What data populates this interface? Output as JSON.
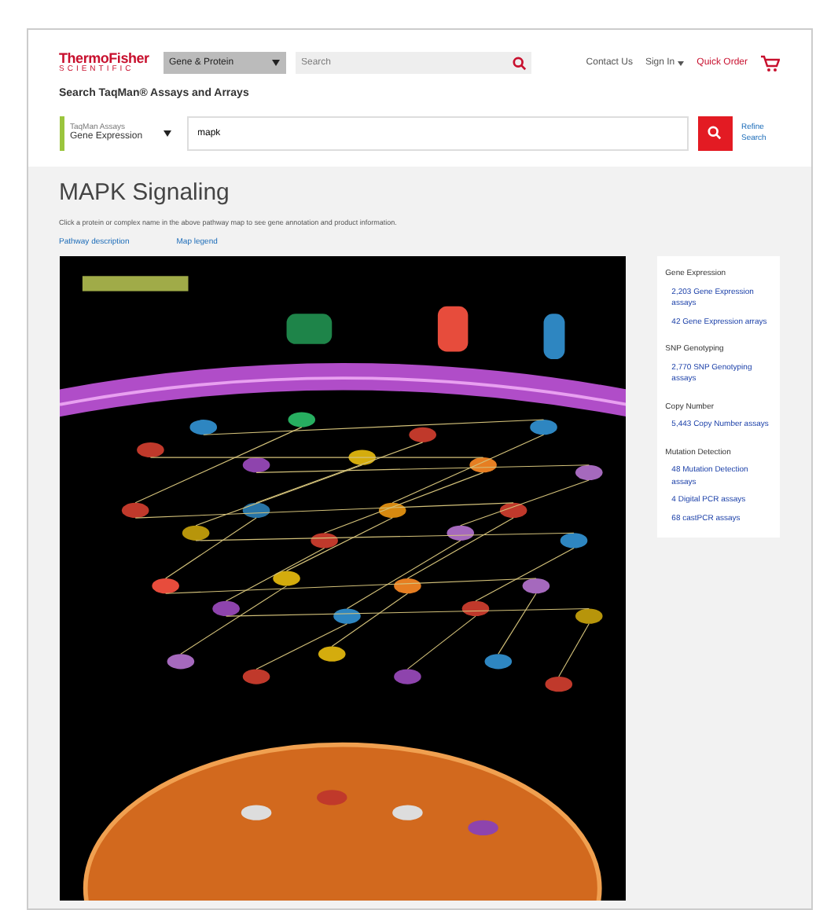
{
  "header": {
    "logo": {
      "line1": "ThermoFisher",
      "line2": "SCIENTIFIC"
    },
    "scope_dropdown": "Gene & Protein",
    "search": {
      "placeholder": "Search"
    },
    "links": [
      {
        "label": "Contact Us",
        "kind": "link"
      },
      {
        "label": "Sign In",
        "kind": "menu"
      },
      {
        "label": "Quick Order",
        "kind": "accent"
      }
    ]
  },
  "assay_search": {
    "title": "Search TaqMan® Assays and Arrays",
    "category": {
      "line1": "TaqMan Assays",
      "line2": "Gene Expression"
    },
    "value": "mapk",
    "side_link": {
      "line1": "Refine",
      "line2": "Search"
    }
  },
  "page": {
    "title": "MAPK Signaling",
    "description": "Click a protein or complex name in the above pathway map to see gene annotation and product information.",
    "links": [
      "Pathway description",
      "Map legend"
    ]
  },
  "sidebar": [
    {
      "heading": "Gene Expression",
      "items": [
        "2,203 Gene Expression assays",
        "42 Gene Expression arrays"
      ]
    },
    {
      "heading": "SNP Genotyping",
      "items": [
        "2,770 SNP Genotyping assays"
      ]
    },
    {
      "heading": "Copy Number",
      "items": [
        "5,443 Copy Number assays"
      ]
    },
    {
      "heading": "Mutation Detection",
      "items": [
        "48 Mutation Detection assays",
        "4 Digital PCR assays",
        "68 castPCR assays"
      ]
    }
  ]
}
